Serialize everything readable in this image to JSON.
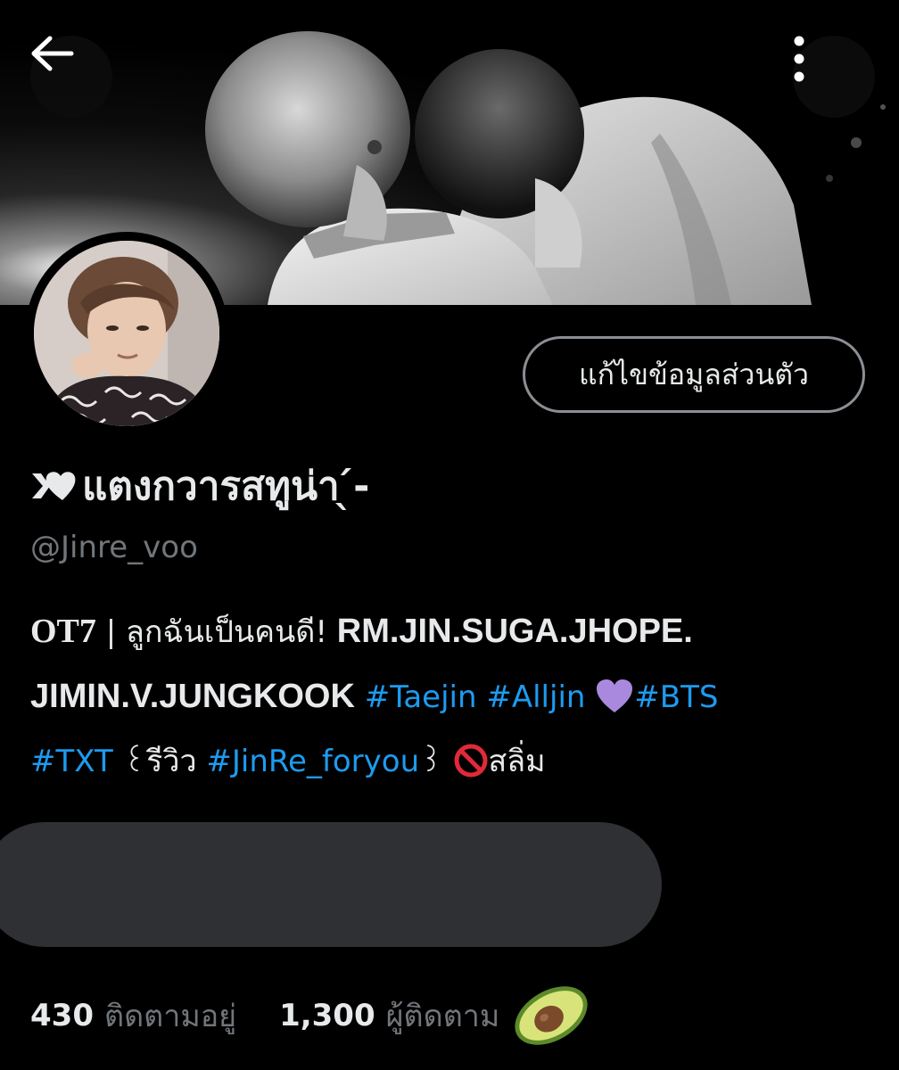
{
  "header": {
    "back_icon": "arrow-left-icon",
    "more_icon": "more-vertical-icon"
  },
  "profile": {
    "edit_button_label": "แก้ไขข้อมูลส่วนตัว",
    "display_name": "แตงกวารสทูน่า ̖́-",
    "display_name_prefix_icon": "heart-arrow-icon",
    "handle": "@Jinre_voo"
  },
  "bio": {
    "ot7": "OT7",
    "separator": " | ",
    "thai_text": "ลูกฉันเป็นคนดี! ",
    "members_line1": "RM.JIN.SUGA.JHOPE.",
    "members_line2": "JIMIN.V.JUNGKOOK",
    "tag_taejin": "#Taejin",
    "tag_alljin": "#Alljin",
    "heart_icon": "purple-heart-icon",
    "tag_bts": "#BTS",
    "tag_txt": "#TXT",
    "review_open": "꒰รีวิว ",
    "tag_jinre": "#JinRe_foryou",
    "review_close": "꒱",
    "no_entry_icon": "prohibited-icon",
    "slim_text": "สลิ่ม"
  },
  "stats": {
    "following_count": "430",
    "following_label": "ติดตามอยู่",
    "followers_count": "1,300",
    "followers_label": "ผู้ติดตาม",
    "avocado_icon": "avocado-icon"
  },
  "colors": {
    "background": "#000000",
    "text_primary": "#e7e9ea",
    "text_secondary": "#71767b",
    "link": "#1d9bf0",
    "redacted_bar": "#2f3033",
    "button_border": "#8b8f94"
  }
}
